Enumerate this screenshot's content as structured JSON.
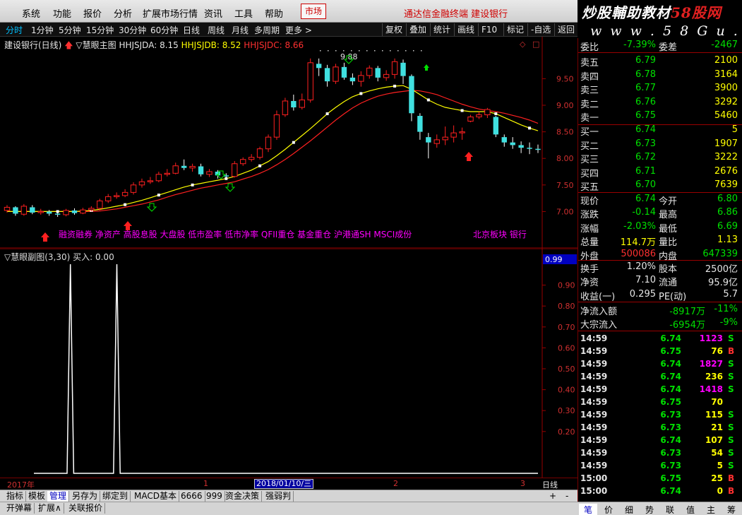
{
  "menu": {
    "items": [
      "系统",
      "功能",
      "报价",
      "分析",
      "扩展市场行情",
      "资讯",
      "工具",
      "帮助"
    ],
    "market": "市场",
    "broker": "通达信金融终端  建设银行"
  },
  "brand": {
    "logo_part1": "炒股輔助教材",
    "logo_part2": "58股网",
    "site": "w w w . 5 8 G u . c o m"
  },
  "periods": {
    "items": [
      "分时",
      "1分钟",
      "5分钟",
      "15分钟",
      "30分钟",
      "60分钟",
      "日线",
      "周线",
      "月线",
      "多周期",
      "更多 >"
    ],
    "active": "分时",
    "tools": [
      "复权",
      "叠加",
      "统计",
      "画线",
      "F10",
      "标记",
      "-自选",
      "返回"
    ]
  },
  "main_chart": {
    "stock": "建设银行(日线)",
    "indicator": "▽慧眼主图",
    "hhjsjda_label": "HHJSJDA: 8.15",
    "hhjsjdb_label": "HHJSJDB: 8.52",
    "hhjsjdc_label": "HHJSJDC: 8.66",
    "peak_label": "9.88",
    "concepts": "融资融券 净资产 高股息股 大盘股 低市盈率 低市净率 QFII重仓 基金重仓 沪港通SH MSCI成份",
    "sector": "北京板块 银行",
    "colors": {
      "up": "#ff2020",
      "down": "#40e0e0",
      "line_a": "#ffff00",
      "line_b": "#ff2020"
    }
  },
  "chart_data": [
    {
      "type": "candlestick",
      "ylim": [
        6.7,
        10.05
      ],
      "ticks": [
        "9.50",
        "9.00",
        "8.50",
        "8.00",
        "7.50",
        "7.00"
      ],
      "candles": [
        {
          "o": 7.02,
          "c": 7.08,
          "h": 7.12,
          "l": 6.98
        },
        {
          "o": 7.08,
          "c": 6.96,
          "h": 7.1,
          "l": 6.92
        },
        {
          "o": 6.95,
          "c": 7.1,
          "h": 7.14,
          "l": 6.92
        },
        {
          "o": 7.08,
          "c": 6.98,
          "h": 7.12,
          "l": 6.95
        },
        {
          "o": 6.98,
          "c": 7.0,
          "h": 7.05,
          "l": 6.94
        },
        {
          "o": 7.0,
          "c": 6.96,
          "h": 7.03,
          "l": 6.92
        },
        {
          "o": 6.96,
          "c": 6.94,
          "h": 7.0,
          "l": 6.9
        },
        {
          "o": 6.94,
          "c": 7.02,
          "h": 7.05,
          "l": 6.91
        },
        {
          "o": 7.02,
          "c": 6.97,
          "h": 7.06,
          "l": 6.94
        },
        {
          "o": 6.97,
          "c": 7.03,
          "h": 7.07,
          "l": 6.95
        },
        {
          "o": 7.03,
          "c": 7.06,
          "h": 7.1,
          "l": 7.0
        },
        {
          "o": 7.06,
          "c": 7.2,
          "h": 7.24,
          "l": 7.02
        },
        {
          "o": 7.2,
          "c": 7.28,
          "h": 7.33,
          "l": 7.16
        },
        {
          "o": 7.28,
          "c": 7.3,
          "h": 7.36,
          "l": 7.24
        },
        {
          "o": 7.3,
          "c": 7.36,
          "h": 7.42,
          "l": 7.27
        },
        {
          "o": 7.36,
          "c": 7.5,
          "h": 7.55,
          "l": 7.32
        },
        {
          "o": 7.5,
          "c": 7.56,
          "h": 7.62,
          "l": 7.45
        },
        {
          "o": 7.56,
          "c": 7.58,
          "h": 7.65,
          "l": 7.52
        },
        {
          "o": 7.58,
          "c": 7.7,
          "h": 7.75,
          "l": 7.55
        },
        {
          "o": 7.7,
          "c": 7.72,
          "h": 7.8,
          "l": 7.66
        },
        {
          "o": 7.72,
          "c": 7.86,
          "h": 7.92,
          "l": 7.7
        },
        {
          "o": 7.86,
          "c": 7.82,
          "h": 7.98,
          "l": 7.78
        },
        {
          "o": 7.82,
          "c": 7.85,
          "h": 7.9,
          "l": 7.75
        },
        {
          "o": 7.85,
          "c": 7.7,
          "h": 7.9,
          "l": 7.66
        },
        {
          "o": 7.7,
          "c": 7.75,
          "h": 7.8,
          "l": 7.65
        },
        {
          "o": 7.75,
          "c": 7.68,
          "h": 7.78,
          "l": 7.62
        },
        {
          "o": 7.68,
          "c": 7.66,
          "h": 7.72,
          "l": 7.62
        },
        {
          "o": 7.66,
          "c": 7.9,
          "h": 7.95,
          "l": 7.64
        },
        {
          "o": 7.9,
          "c": 7.98,
          "h": 8.02,
          "l": 7.86
        },
        {
          "o": 7.98,
          "c": 8.02,
          "h": 8.08,
          "l": 7.94
        },
        {
          "o": 8.02,
          "c": 8.18,
          "h": 8.22,
          "l": 7.98
        },
        {
          "o": 8.18,
          "c": 8.4,
          "h": 8.45,
          "l": 8.12
        },
        {
          "o": 8.4,
          "c": 8.82,
          "h": 8.9,
          "l": 8.35
        },
        {
          "o": 8.82,
          "c": 9.08,
          "h": 9.14,
          "l": 8.78
        },
        {
          "o": 9.08,
          "c": 8.96,
          "h": 9.2,
          "l": 8.9
        },
        {
          "o": 8.96,
          "c": 9.1,
          "h": 9.22,
          "l": 8.92
        },
        {
          "o": 9.1,
          "c": 9.8,
          "h": 9.88,
          "l": 9.05
        },
        {
          "o": 9.78,
          "c": 9.7,
          "h": 9.88,
          "l": 9.55
        },
        {
          "o": 9.7,
          "c": 9.45,
          "h": 9.76,
          "l": 9.35
        },
        {
          "o": 9.45,
          "c": 9.72,
          "h": 9.78,
          "l": 9.4
        },
        {
          "o": 9.72,
          "c": 9.52,
          "h": 9.8,
          "l": 9.48
        },
        {
          "o": 9.52,
          "c": 9.45,
          "h": 9.6,
          "l": 9.38
        },
        {
          "o": 9.45,
          "c": 9.56,
          "h": 9.64,
          "l": 9.35
        },
        {
          "o": 9.56,
          "c": 9.7,
          "h": 9.75,
          "l": 9.5
        },
        {
          "o": 9.7,
          "c": 9.52,
          "h": 9.74,
          "l": 9.45
        },
        {
          "o": 9.52,
          "c": 9.58,
          "h": 9.66,
          "l": 9.46
        },
        {
          "o": 9.58,
          "c": 9.82,
          "h": 9.88,
          "l": 9.5
        },
        {
          "o": 9.8,
          "c": 9.55,
          "h": 9.86,
          "l": 9.4
        },
        {
          "o": 9.55,
          "c": 8.85,
          "h": 9.58,
          "l": 8.7
        },
        {
          "o": 8.8,
          "c": 8.5,
          "h": 8.85,
          "l": 8.35
        },
        {
          "o": 8.4,
          "c": 8.3,
          "h": 8.48,
          "l": 8.0
        },
        {
          "o": 8.28,
          "c": 8.35,
          "h": 8.45,
          "l": 8.2
        },
        {
          "o": 8.35,
          "c": 8.4,
          "h": 8.6,
          "l": 8.25
        },
        {
          "o": 8.4,
          "c": 8.48,
          "h": 8.62,
          "l": 8.3
        },
        {
          "o": 8.48,
          "c": 8.5,
          "h": 8.58,
          "l": 8.35
        },
        {
          "o": 8.7,
          "c": 8.78,
          "h": 8.82,
          "l": 8.68
        },
        {
          "o": 8.78,
          "c": 8.82,
          "h": 8.88,
          "l": 8.74
        },
        {
          "o": 8.82,
          "c": 8.92,
          "h": 8.95,
          "l": 8.76
        },
        {
          "o": 8.78,
          "c": 8.45,
          "h": 8.8,
          "l": 8.4
        },
        {
          "o": 8.4,
          "c": 8.3,
          "h": 8.45,
          "l": 8.22
        },
        {
          "o": 8.3,
          "c": 8.25,
          "h": 8.4,
          "l": 8.18
        },
        {
          "o": 8.25,
          "c": 8.2,
          "h": 8.32,
          "l": 8.1
        },
        {
          "o": 8.2,
          "c": 8.18,
          "h": 8.3,
          "l": 8.08
        },
        {
          "o": 8.18,
          "c": 8.16,
          "h": 8.26,
          "l": 8.1
        }
      ],
      "line_a": [
        7.0,
        7.0,
        7.0,
        7.0,
        7.0,
        7.0,
        7.0,
        7.0,
        7.0,
        7.01,
        7.02,
        7.04,
        7.07,
        7.1,
        7.13,
        7.17,
        7.21,
        7.26,
        7.31,
        7.36,
        7.41,
        7.46,
        7.5,
        7.53,
        7.56,
        7.59,
        7.62,
        7.66,
        7.72,
        7.78,
        7.86,
        7.94,
        8.05,
        8.17,
        8.3,
        8.43,
        8.56,
        8.7,
        8.84,
        8.96,
        9.07,
        9.16,
        9.22,
        9.27,
        9.31,
        9.34,
        9.36,
        9.37,
        9.3,
        9.2,
        9.1,
        9.02,
        8.96,
        8.93,
        8.9,
        8.88,
        8.88,
        8.88,
        8.84,
        8.77,
        8.7,
        8.63,
        8.57,
        8.52
      ],
      "line_b": [
        7.0,
        7.0,
        7.0,
        7.0,
        7.0,
        7.0,
        7.0,
        7.0,
        7.0,
        7.0,
        7.0,
        7.01,
        7.03,
        7.05,
        7.08,
        7.11,
        7.14,
        7.18,
        7.22,
        7.27,
        7.32,
        7.36,
        7.4,
        7.44,
        7.47,
        7.5,
        7.53,
        7.56,
        7.61,
        7.66,
        7.72,
        7.79,
        7.88,
        7.98,
        8.09,
        8.21,
        8.33,
        8.46,
        8.59,
        8.72,
        8.84,
        8.95,
        9.04,
        9.11,
        9.17,
        9.21,
        9.24,
        9.26,
        9.28,
        9.27,
        9.24,
        9.2,
        9.14,
        9.08,
        9.02,
        8.97,
        8.93,
        8.9,
        8.88,
        8.85,
        8.81,
        8.77,
        8.72,
        8.66
      ]
    },
    {
      "type": "line",
      "series": [
        {
          "values": [
            0,
            0,
            0,
            0,
            0,
            0,
            0,
            0,
            0,
            0,
            0,
            1,
            0,
            0,
            0,
            0,
            0,
            0,
            0,
            0,
            0,
            0,
            0,
            0,
            0,
            1,
            0,
            0,
            0,
            0,
            0,
            0,
            0,
            0,
            0,
            0,
            0,
            0,
            0,
            0,
            0,
            0,
            0,
            0,
            0,
            0,
            0,
            0,
            0,
            0,
            0,
            0,
            0,
            0,
            0,
            0,
            0,
            0,
            0,
            0,
            0,
            0,
            0,
            0,
            0,
            0,
            0,
            0,
            0,
            0,
            0,
            0,
            0,
            0,
            0,
            0,
            0,
            0,
            0,
            0,
            0,
            0,
            0,
            0,
            0,
            0,
            0,
            0,
            0,
            0,
            0,
            0,
            0,
            0,
            0,
            0,
            0,
            0,
            0,
            0,
            0,
            0,
            0,
            0,
            0,
            0,
            0,
            0,
            0,
            0,
            0,
            0,
            0,
            0,
            0,
            0,
            0,
            0,
            0,
            0,
            0,
            0,
            0,
            0,
            0,
            0,
            0,
            0,
            0,
            0,
            0,
            0,
            0,
            0,
            0,
            0,
            0,
            0,
            0,
            0,
            0,
            0,
            0,
            0,
            0,
            0,
            0,
            0,
            0,
            0,
            0,
            0,
            0,
            0,
            0,
            0,
            0,
            0,
            0,
            0,
            0
          ]
        }
      ],
      "ylim": [
        0,
        1.0
      ],
      "ticks": [
        "0.99",
        "0.90",
        "0.80",
        "0.70",
        "0.60",
        "0.50",
        "0.40",
        "0.30",
        "0.20"
      ]
    }
  ],
  "sub_chart": {
    "title": "▽慧眼副图(3,30)  买入: 0.00",
    "value_badge": "0.99"
  },
  "datebar": {
    "year": "2017年",
    "m1": "1",
    "cursor": "2018/01/10/三",
    "m2": "2",
    "m3": "3",
    "period": "日线"
  },
  "bottom_tabs1": [
    "指标",
    "模板",
    "管理",
    "另存为",
    "绑定到",
    "MACD基本",
    "6666",
    "999",
    "资金决策",
    "强弱判"
  ],
  "bottom_tabs1_active": "管理",
  "bottom_tabs1_right": [
    "+",
    "-"
  ],
  "bottom_tabs2": [
    "开弹幕",
    "扩展∧",
    "关联报价"
  ],
  "quote": {
    "weibi": {
      "label": "委比",
      "value": "-7.39%",
      "label2": "委差",
      "value2": "-2467"
    },
    "asks": [
      {
        "label": "卖五",
        "price": "6.79",
        "vol": "2100"
      },
      {
        "label": "卖四",
        "price": "6.78",
        "vol": "3164"
      },
      {
        "label": "卖三",
        "price": "6.77",
        "vol": "3900"
      },
      {
        "label": "卖二",
        "price": "6.76",
        "vol": "3292"
      },
      {
        "label": "卖一",
        "price": "6.75",
        "vol": "5460"
      }
    ],
    "bids": [
      {
        "label": "买一",
        "price": "6.74",
        "vol": "5"
      },
      {
        "label": "买二",
        "price": "6.73",
        "vol": "1907"
      },
      {
        "label": "买三",
        "price": "6.72",
        "vol": "3222"
      },
      {
        "label": "买四",
        "price": "6.71",
        "vol": "2676"
      },
      {
        "label": "买五",
        "price": "6.70",
        "vol": "7639"
      }
    ],
    "stats": [
      {
        "l1": "现价",
        "v1": "6.74",
        "c1": "g",
        "l2": "今开",
        "v2": "6.80",
        "c2": "g"
      },
      {
        "l1": "涨跌",
        "v1": "-0.14",
        "c1": "g",
        "l2": "最高",
        "v2": "6.86",
        "c2": "g"
      },
      {
        "l1": "涨幅",
        "v1": "-2.03%",
        "c1": "g",
        "l2": "最低",
        "v2": "6.69",
        "c2": "g"
      },
      {
        "l1": "总量",
        "v1": "114.7万",
        "c1": "y",
        "l2": "量比",
        "v2": "1.13",
        "c2": "y"
      },
      {
        "l1": "外盘",
        "v1": "500086",
        "c1": "r",
        "l2": "内盘",
        "v2": "647339",
        "c2": "g"
      }
    ],
    "fund": [
      {
        "l1": "换手",
        "v1": "1.20%",
        "l2": "股本",
        "v2": "2500亿"
      },
      {
        "l1": "净资",
        "v1": "7.10",
        "l2": "流通",
        "v2": "95.9亿"
      },
      {
        "l1": "收益(一)",
        "v1": "0.295",
        "l2": "PE(动)",
        "v2": "5.7"
      }
    ],
    "flow": [
      {
        "label": "净流入额",
        "value": "-8917万",
        "pct": "-11%"
      },
      {
        "label": "大宗流入",
        "value": "-6954万",
        "pct": "-9%"
      }
    ]
  },
  "ticks": [
    {
      "t": "14:59",
      "p": "6.74",
      "v": "1123",
      "bs": "S",
      "vc": "m"
    },
    {
      "t": "14:59",
      "p": "6.75",
      "v": "76",
      "bs": "B",
      "vc": "y"
    },
    {
      "t": "14:59",
      "p": "6.74",
      "v": "1827",
      "bs": "S",
      "vc": "m"
    },
    {
      "t": "14:59",
      "p": "6.74",
      "v": "236",
      "bs": "S",
      "vc": "y"
    },
    {
      "t": "14:59",
      "p": "6.74",
      "v": "1418",
      "bs": "S",
      "vc": "m"
    },
    {
      "t": "14:59",
      "p": "6.75",
      "v": "70",
      "bs": "",
      "vc": "y"
    },
    {
      "t": "14:59",
      "p": "6.73",
      "v": "115",
      "bs": "S",
      "vc": "y"
    },
    {
      "t": "14:59",
      "p": "6.73",
      "v": "21",
      "bs": "S",
      "vc": "y"
    },
    {
      "t": "14:59",
      "p": "6.74",
      "v": "107",
      "bs": "S",
      "vc": "y"
    },
    {
      "t": "14:59",
      "p": "6.73",
      "v": "54",
      "bs": "S",
      "vc": "y"
    },
    {
      "t": "14:59",
      "p": "6.73",
      "v": "5",
      "bs": "S",
      "vc": "y"
    },
    {
      "t": "15:00",
      "p": "6.75",
      "v": "25",
      "bs": "B",
      "vc": "y"
    },
    {
      "t": "15:00",
      "p": "6.74",
      "v": "0",
      "bs": "B",
      "vc": "y"
    }
  ],
  "right_tabs": [
    "笔",
    "价",
    "细",
    "势",
    "联",
    "值",
    "主",
    "筹"
  ],
  "right_tabs_active": "笔"
}
